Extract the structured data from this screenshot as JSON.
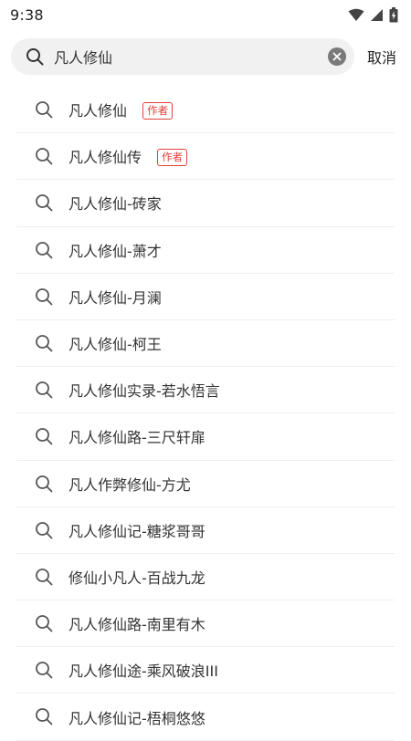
{
  "status_bar": {
    "time": "9:38",
    "icons": [
      "wifi-icon",
      "signal-icon",
      "battery-icon"
    ]
  },
  "search": {
    "query": "凡人修仙",
    "placeholder": "",
    "cancel_label": "取消"
  },
  "suggestions": [
    {
      "text": "凡人修仙",
      "badge": "作者"
    },
    {
      "text": "凡人修仙传",
      "badge": "作者"
    },
    {
      "text": "凡人修仙-砖家",
      "badge": ""
    },
    {
      "text": "凡人修仙-萧才",
      "badge": ""
    },
    {
      "text": "凡人修仙-月澜",
      "badge": ""
    },
    {
      "text": "凡人修仙-柯王",
      "badge": ""
    },
    {
      "text": "凡人修仙实录-若水悟言",
      "badge": ""
    },
    {
      "text": "凡人修仙路-三尺轩扉",
      "badge": ""
    },
    {
      "text": "凡人作弊修仙-方尤",
      "badge": ""
    },
    {
      "text": "凡人修仙记-糖浆哥哥",
      "badge": ""
    },
    {
      "text": "修仙小凡人-百战九龙",
      "badge": ""
    },
    {
      "text": "凡人修仙路-南里有木",
      "badge": ""
    },
    {
      "text": "凡人修仙途-乘风破浪III",
      "badge": ""
    },
    {
      "text": "凡人修仙记-梧桐悠悠",
      "badge": ""
    }
  ],
  "colors": {
    "badge": "#e0413a",
    "search_bg": "#f1f1f1",
    "divider": "#efefef"
  }
}
